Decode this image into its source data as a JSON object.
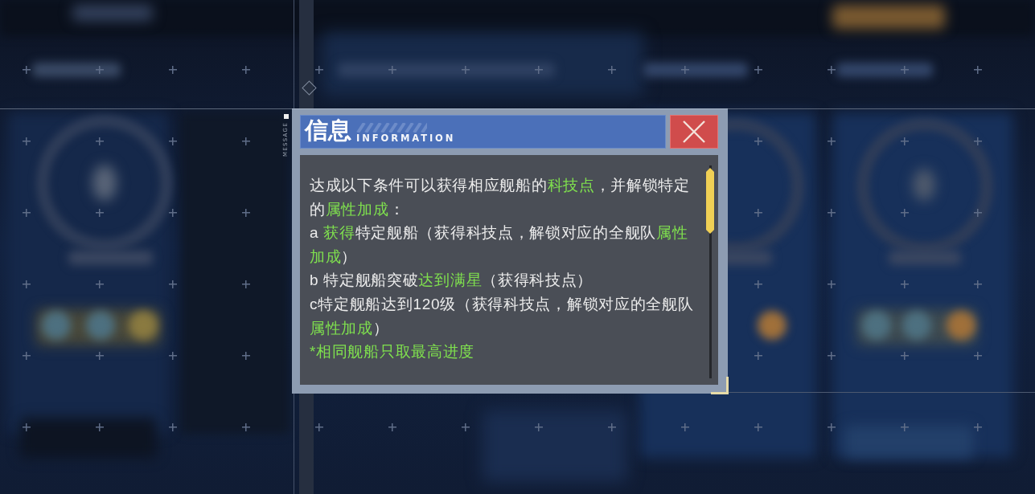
{
  "side_label": "MESSAGE",
  "dialog": {
    "title": "信息",
    "subtitle": "INFORMATION",
    "paragraphs": [
      {
        "segments": [
          {
            "text": "达成以下条件可以获得相应舰船的",
            "highlight": false
          },
          {
            "text": "科技点",
            "highlight": true
          },
          {
            "text": "，并解锁特定的",
            "highlight": false
          },
          {
            "text": "属性加成",
            "highlight": true
          },
          {
            "text": "：",
            "highlight": false
          }
        ]
      },
      {
        "segments": [
          {
            "text": "a ",
            "highlight": false
          },
          {
            "text": "获得",
            "highlight": true
          },
          {
            "text": "特定舰船（获得科技点，解锁对应的全舰队",
            "highlight": false
          },
          {
            "text": "属性加成",
            "highlight": true
          },
          {
            "text": "）",
            "highlight": false
          }
        ]
      },
      {
        "segments": [
          {
            "text": "b 特定舰船突破",
            "highlight": false
          },
          {
            "text": "达到满星",
            "highlight": true
          },
          {
            "text": "（获得科技点）",
            "highlight": false
          }
        ]
      },
      {
        "segments": [
          {
            "text": "c特定舰船达到120级（获得科技点，解锁对应的全舰队",
            "highlight": false
          },
          {
            "text": "属性加成",
            "highlight": true
          },
          {
            "text": "）",
            "highlight": false
          }
        ]
      },
      {
        "segments": [
          {
            "text": "*相同舰船只取最高进度",
            "highlight": true
          }
        ]
      }
    ]
  }
}
